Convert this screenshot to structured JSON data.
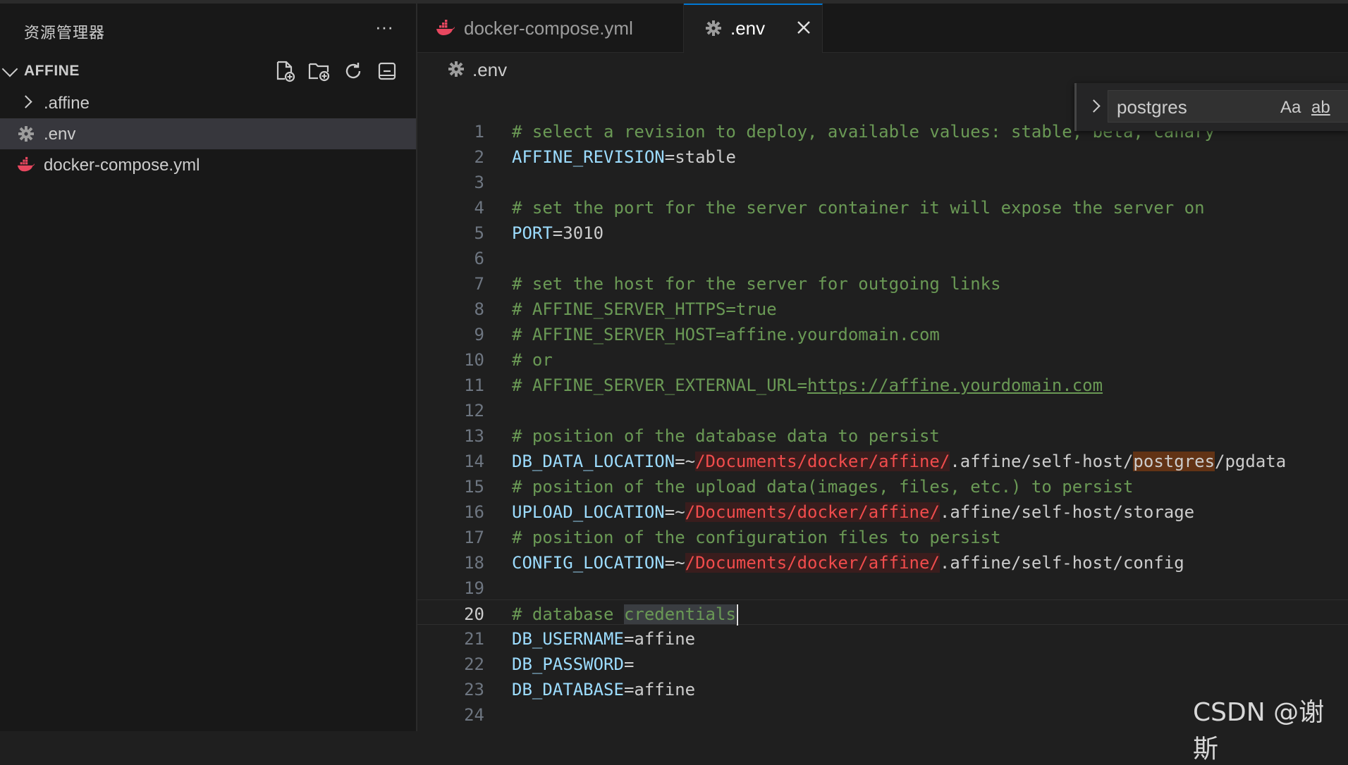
{
  "explorer": {
    "title": "资源管理器",
    "more": "···",
    "section": "AFFINE",
    "actions": [
      "new-file-icon",
      "new-folder-icon",
      "refresh-icon",
      "collapse-all-icon"
    ],
    "items": [
      {
        "label": ".affine",
        "type": "folder"
      },
      {
        "label": ".env",
        "type": "env-gear"
      },
      {
        "label": "docker-compose.yml",
        "type": "docker"
      }
    ]
  },
  "tabs": [
    {
      "label": "docker-compose.yml",
      "icon": "docker-icon",
      "active": false
    },
    {
      "label": ".env",
      "icon": "gear-icon",
      "active": true
    }
  ],
  "breadcrumb": {
    "label": ".env"
  },
  "find": {
    "query": "postgres",
    "match_case": "Aa",
    "whole_word": "ab"
  },
  "editor": {
    "current_line": 20,
    "lines": [
      {
        "n": "1",
        "segs": [
          [
            "cm",
            "# select a revision to deploy, available values: stable, beta, canary"
          ]
        ]
      },
      {
        "n": "2",
        "segs": [
          [
            "key",
            "AFFINE_REVISION"
          ],
          [
            "val",
            "=stable"
          ]
        ]
      },
      {
        "n": "3",
        "segs": []
      },
      {
        "n": "4",
        "segs": [
          [
            "cm",
            "# set the port for the server container it will expose the server on"
          ]
        ]
      },
      {
        "n": "5",
        "segs": [
          [
            "key",
            "PORT"
          ],
          [
            "val",
            "=3010"
          ]
        ]
      },
      {
        "n": "6",
        "segs": []
      },
      {
        "n": "7",
        "segs": [
          [
            "cm",
            "# set the host for the server for outgoing links"
          ]
        ]
      },
      {
        "n": "8",
        "segs": [
          [
            "cm",
            "# AFFINE_SERVER_HTTPS=true"
          ]
        ]
      },
      {
        "n": "9",
        "segs": [
          [
            "cm",
            "# AFFINE_SERVER_HOST=affine.yourdomain.com"
          ]
        ]
      },
      {
        "n": "10",
        "segs": [
          [
            "cm",
            "# or"
          ]
        ]
      },
      {
        "n": "11",
        "segs": [
          [
            "cm",
            "# AFFINE_SERVER_EXTERNAL_URL="
          ],
          [
            "link",
            "https://affine.yourdomain.com"
          ]
        ]
      },
      {
        "n": "12",
        "segs": []
      },
      {
        "n": "13",
        "segs": [
          [
            "cm",
            "# position of the database data to persist"
          ]
        ]
      },
      {
        "n": "14",
        "segs": [
          [
            "key",
            "DB_DATA_LOCATION"
          ],
          [
            "val",
            "=~"
          ],
          [
            "path",
            "/Documents/docker/affine/"
          ],
          [
            "val",
            ".affine/self-host/"
          ],
          [
            "hl",
            "postgres"
          ],
          [
            "val",
            "/pgdata"
          ]
        ]
      },
      {
        "n": "15",
        "segs": [
          [
            "cm",
            "# position of the upload data(images, files, etc.) to persist"
          ]
        ]
      },
      {
        "n": "16",
        "segs": [
          [
            "key",
            "UPLOAD_LOCATION"
          ],
          [
            "val",
            "=~"
          ],
          [
            "path",
            "/Documents/docker/affine/"
          ],
          [
            "val",
            ".affine/self-host/storage"
          ]
        ]
      },
      {
        "n": "17",
        "segs": [
          [
            "cm",
            "# position of the configuration files to persist"
          ]
        ]
      },
      {
        "n": "18",
        "segs": [
          [
            "key",
            "CONFIG_LOCATION"
          ],
          [
            "val",
            "=~"
          ],
          [
            "path",
            "/Documents/docker/affine/"
          ],
          [
            "val",
            ".affine/self-host/config"
          ]
        ]
      },
      {
        "n": "19",
        "segs": []
      },
      {
        "n": "20",
        "segs": [
          [
            "cm",
            "# database "
          ],
          [
            "cm sel",
            "credentials"
          ]
        ]
      },
      {
        "n": "21",
        "segs": [
          [
            "key",
            "DB_USERNAME"
          ],
          [
            "val",
            "=affine"
          ]
        ]
      },
      {
        "n": "22",
        "segs": [
          [
            "key",
            "DB_PASSWORD"
          ],
          [
            "val",
            "="
          ]
        ]
      },
      {
        "n": "23",
        "segs": [
          [
            "key",
            "DB_DATABASE"
          ],
          [
            "val",
            "=affine"
          ]
        ]
      },
      {
        "n": "24",
        "segs": []
      }
    ]
  },
  "watermark": "CSDN @谢斯",
  "colors": {
    "accent": "#0078d4",
    "comment": "#6a9955",
    "key": "#9cdcfe",
    "path": "#f14c4c",
    "docker": "#e8475f"
  }
}
